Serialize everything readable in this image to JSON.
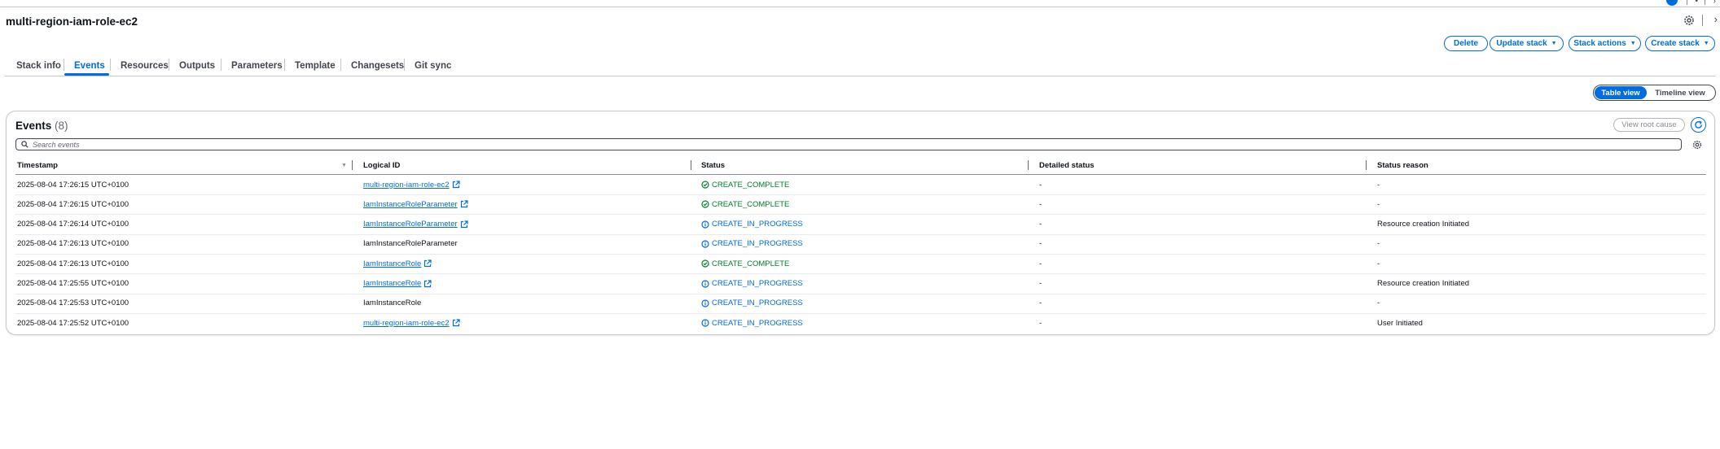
{
  "stack": {
    "name": "multi-region-iam-role-ec2"
  },
  "actions": {
    "delete": "Delete",
    "update_stack": "Update stack",
    "stack_actions": "Stack actions",
    "create_stack": "Create stack"
  },
  "tabs": [
    {
      "label": "Stack info"
    },
    {
      "label": "Events",
      "active": true
    },
    {
      "label": "Resources"
    },
    {
      "label": "Outputs"
    },
    {
      "label": "Parameters"
    },
    {
      "label": "Template"
    },
    {
      "label": "Changesets"
    },
    {
      "label": "Git sync"
    }
  ],
  "views": {
    "table": "Table view",
    "timeline": "Timeline view",
    "selected": "Table view"
  },
  "events": {
    "title": "Events",
    "count": "(8)",
    "view_root_cause": "View root cause",
    "search_placeholder": "Search events",
    "columns": {
      "timestamp": "Timestamp",
      "logical_id": "Logical ID",
      "status": "Status",
      "detailed_status": "Detailed status",
      "status_reason": "Status reason"
    },
    "rows": [
      {
        "timestamp": "2025-08-04 17:26:15 UTC+0100",
        "logical_id": "multi-region-iam-role-ec2",
        "link": true,
        "status": "CREATE_COMPLETE",
        "detailed_status": "-",
        "status_reason": "-"
      },
      {
        "timestamp": "2025-08-04 17:26:15 UTC+0100",
        "logical_id": "IamInstanceRoleParameter",
        "link": true,
        "status": "CREATE_COMPLETE",
        "detailed_status": "-",
        "status_reason": "-"
      },
      {
        "timestamp": "2025-08-04 17:26:14 UTC+0100",
        "logical_id": "IamInstanceRoleParameter",
        "link": true,
        "status": "CREATE_IN_PROGRESS",
        "detailed_status": "-",
        "status_reason": "Resource creation Initiated"
      },
      {
        "timestamp": "2025-08-04 17:26:13 UTC+0100",
        "logical_id": "IamInstanceRoleParameter",
        "link": false,
        "status": "CREATE_IN_PROGRESS",
        "detailed_status": "-",
        "status_reason": "-"
      },
      {
        "timestamp": "2025-08-04 17:26:13 UTC+0100",
        "logical_id": "IamInstanceRole",
        "link": true,
        "status": "CREATE_COMPLETE",
        "detailed_status": "-",
        "status_reason": "-"
      },
      {
        "timestamp": "2025-08-04 17:25:55 UTC+0100",
        "logical_id": "IamInstanceRole",
        "link": true,
        "status": "CREATE_IN_PROGRESS",
        "detailed_status": "-",
        "status_reason": "Resource creation Initiated"
      },
      {
        "timestamp": "2025-08-04 17:25:53 UTC+0100",
        "logical_id": "IamInstanceRole",
        "link": false,
        "status": "CREATE_IN_PROGRESS",
        "detailed_status": "-",
        "status_reason": "-"
      },
      {
        "timestamp": "2025-08-04 17:25:52 UTC+0100",
        "logical_id": "multi-region-iam-role-ec2",
        "link": true,
        "status": "CREATE_IN_PROGRESS",
        "detailed_status": "-",
        "status_reason": "User Initiated"
      }
    ]
  },
  "colors": {
    "accent": "#006ce0",
    "success": "#00802f",
    "text": "#0f141a",
    "border": "#c6c6cd"
  },
  "icons": {
    "header": [
      "settings-gear-icon",
      "chevron-right-icon"
    ],
    "status_complete": "check-circle-icon",
    "status_in_progress": "info-circle-icon",
    "link": "external-link-icon",
    "refresh": "refresh-icon",
    "search": "search-icon",
    "table_settings": "settings-gear-icon"
  }
}
